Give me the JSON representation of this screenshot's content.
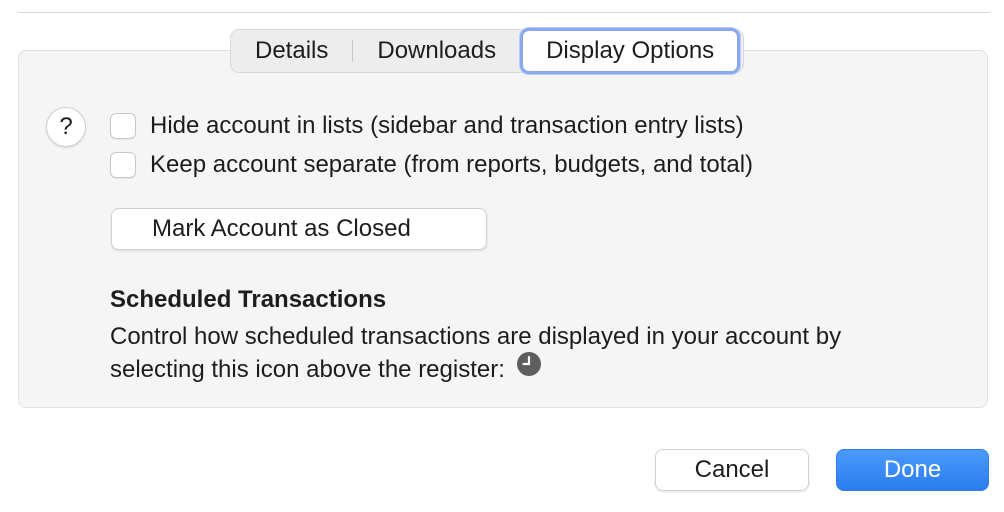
{
  "tabs": [
    {
      "label": "Details",
      "selected": false
    },
    {
      "label": "Downloads",
      "selected": false
    },
    {
      "label": "Display Options",
      "selected": true
    }
  ],
  "help": {
    "label": "?"
  },
  "options": {
    "hide_account": {
      "label": "Hide account in lists (sidebar and transaction entry lists)",
      "checked": false
    },
    "keep_separate": {
      "label": "Keep account separate (from reports, budgets, and total)",
      "checked": false
    }
  },
  "mark_closed_label": "Mark Account as Closed",
  "scheduled": {
    "title": "Scheduled Transactions",
    "description": "Control how scheduled transactions are displayed in your account by selecting this icon above the register:",
    "icon": "clock-icon"
  },
  "footer": {
    "cancel_label": "Cancel",
    "done_label": "Done"
  },
  "colors": {
    "accent": "#2b7cf0",
    "focus_ring": "#8aa8ef",
    "panel_bg": "#f5f5f5"
  }
}
